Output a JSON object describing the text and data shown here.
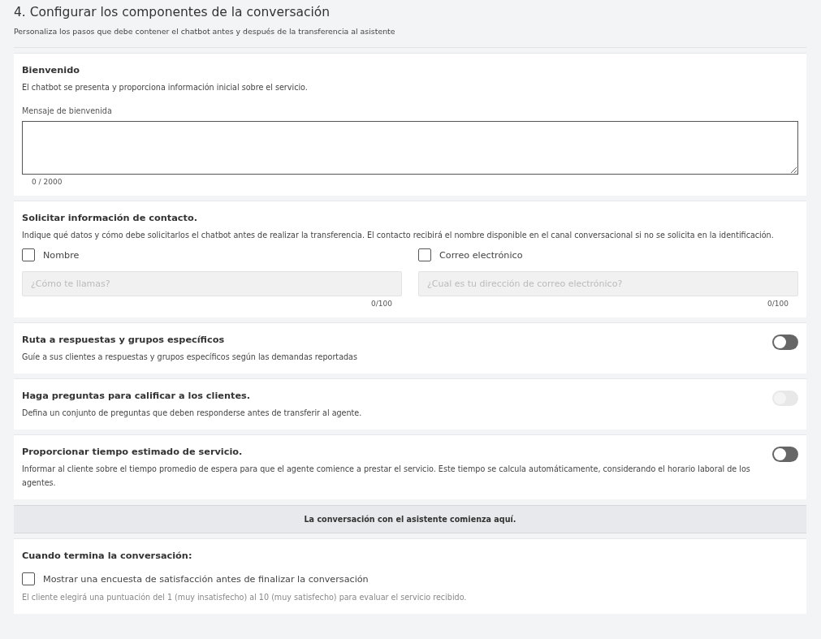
{
  "header": {
    "title": "4. Configurar los componentes de la conversación",
    "subtitle": "Personaliza los pasos que debe contener el chatbot antes y después de la transferencia al asistente"
  },
  "welcome": {
    "title": "Bienvenido",
    "description": "El chatbot se presenta y proporciona información inicial sobre el servicio.",
    "field_label": "Mensaje de bienvenida",
    "counter": "0 / 2000"
  },
  "contact": {
    "title": "Solicitar información de contacto.",
    "description": "Indique qué datos y cómo debe solicitarlos el chatbot antes de realizar la transferencia. El contacto recibirá el nombre disponible en el canal conversacional si no se solicita en la identificación.",
    "fields": [
      {
        "label": "Nombre",
        "checked": false,
        "placeholder": "¿Cómo te llamas?",
        "counter": "0/100"
      },
      {
        "label": "Correo electrónico",
        "checked": false,
        "placeholder": "¿Cual es tu dirección de correo electrónico?",
        "counter": "0/100"
      }
    ]
  },
  "options": [
    {
      "title": "Ruta a respuestas y grupos específicos",
      "description": "Guíe a sus clientes a respuestas y grupos específicos según las demandas reportadas",
      "on": false,
      "disabled": false
    },
    {
      "title": "Haga preguntas para calificar a los clientes.",
      "description": "Defina un conjunto de preguntas que deben responderse antes de transferir al agente.",
      "on": false,
      "disabled": true
    },
    {
      "title": "Proporcionar tiempo estimado de servicio.",
      "description": "Informar al cliente sobre el tiempo promedio de espera para que el agente comience a prestar el servicio. Este tiempo se calcula automáticamente, considerando el horario laboral de los agentes.",
      "on": false,
      "disabled": false
    }
  ],
  "banner": "La conversación con el asistente comienza aquí.",
  "ending": {
    "title": "Cuando termina la conversación:",
    "survey_label": "Mostrar una encuesta de satisfacción antes de finalizar la conversación",
    "survey_checked": false,
    "note": "El cliente elegirá una puntuación del 1 (muy insatisfecho) al 10 (muy satisfecho) para evaluar el servicio recibido."
  }
}
